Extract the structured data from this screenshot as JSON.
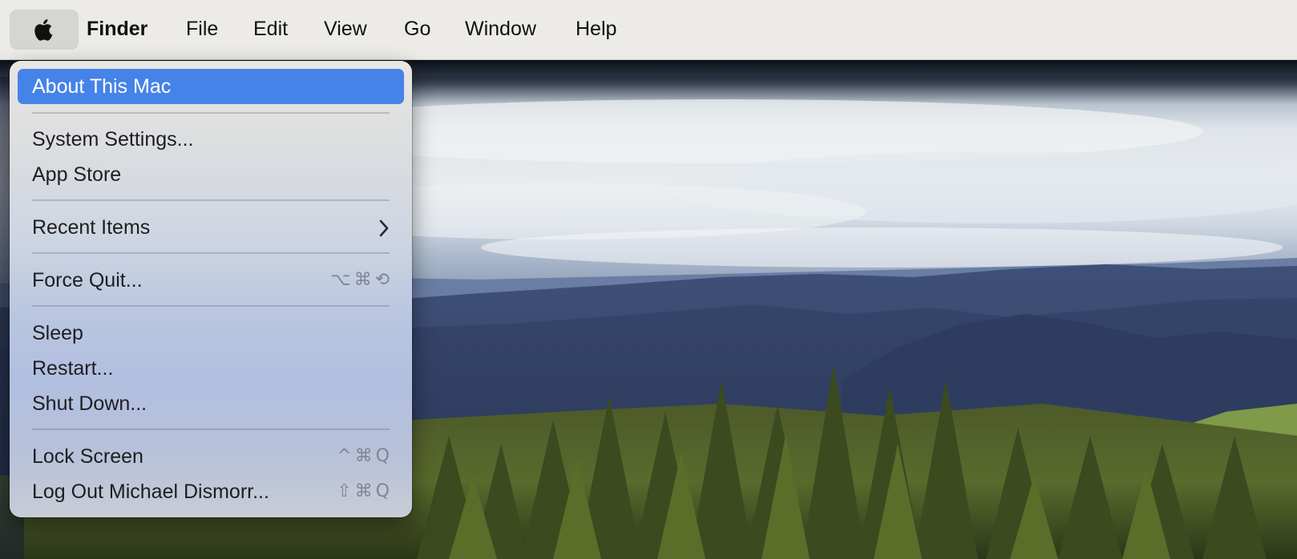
{
  "menubar": {
    "apple_icon": "apple-logo-icon",
    "app_name": "Finder",
    "items": [
      "File",
      "Edit",
      "View",
      "Go",
      "Window",
      "Help"
    ]
  },
  "apple_menu": {
    "items": [
      {
        "label": "About This Mac",
        "highlighted": true
      },
      {
        "label": "System Settings..."
      },
      {
        "label": "App Store"
      },
      {
        "label": "Recent Items",
        "submenu": true
      },
      {
        "label": "Force Quit...",
        "shortcut": [
          "⌥",
          "⌘",
          "⟲"
        ]
      },
      {
        "label": "Sleep"
      },
      {
        "label": "Restart..."
      },
      {
        "label": "Shut Down..."
      },
      {
        "label": "Lock Screen",
        "shortcut": [
          "^",
          "⌘",
          "Q"
        ]
      },
      {
        "label": "Log Out Michael Dismorr...",
        "shortcut": [
          "⇧",
          "⌘",
          "Q"
        ]
      }
    ]
  },
  "colors": {
    "menubar_bg": "#ecebe7",
    "highlight": "#4683e8",
    "shortcut_text": "#7f8591"
  }
}
